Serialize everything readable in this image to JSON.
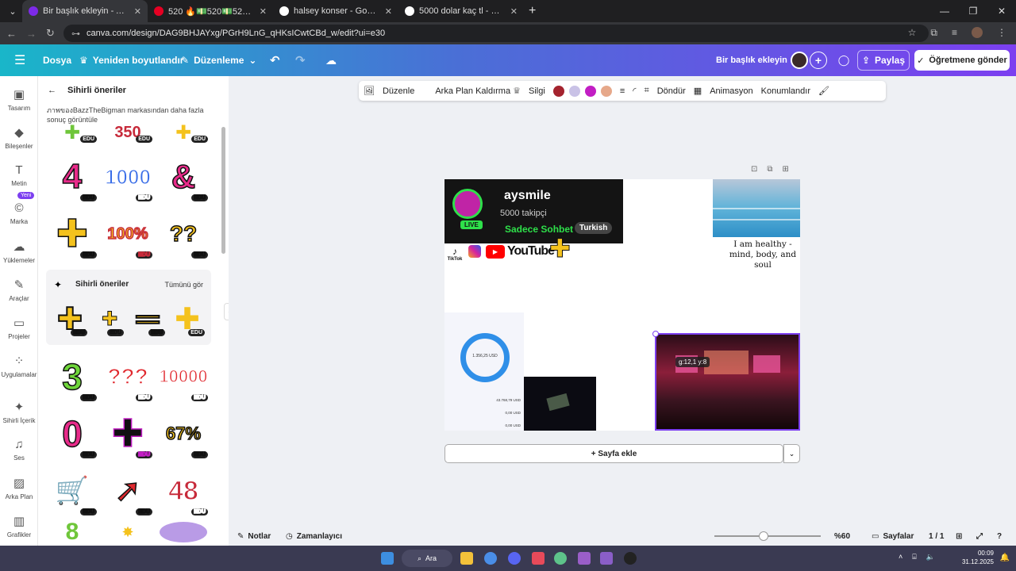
{
  "browser": {
    "tabs": [
      {
        "title": "Bir başlık ekleyin - A4 (Yatay)",
        "active": true,
        "fav_color": "#7d2ae8"
      },
      {
        "title": "520 🔥💵520💵520💵520",
        "active": false,
        "fav_color": "#e60023"
      },
      {
        "title": "halsey konser - Google'da Ara",
        "active": false,
        "fav_color": "#ffffff"
      },
      {
        "title": "5000 dolar kaç tl - Google'da A",
        "active": false,
        "fav_color": "#ffffff"
      }
    ],
    "url": "canva.com/design/DAG9BHJAYxg/PGrH9LnG_qHKsICwtCBd_w/edit?ui=e30"
  },
  "topbar": {
    "file": "Dosya",
    "resize": "Yeniden boyutlandır",
    "edit": "Düzenleme",
    "doc_title": "Bir başlık ekleyin",
    "share": "Paylaş",
    "teacher": "Öğretmene gönder"
  },
  "rail": [
    {
      "label": "Tasarım",
      "icon": "▣"
    },
    {
      "label": "Bileşenler",
      "icon": "◆"
    },
    {
      "label": "Metin",
      "icon": "T"
    },
    {
      "label": "Marka",
      "icon": "©",
      "badge": "Yeni"
    },
    {
      "label": "Yüklemeler",
      "icon": "☁"
    },
    {
      "label": "Araçlar",
      "icon": "✎"
    },
    {
      "label": "Projeler",
      "icon": "▭"
    },
    {
      "label": "Uygulamalar",
      "icon": "⁘"
    },
    {
      "label": "Sihirli İçerik",
      "icon": "✦"
    },
    {
      "label": "Ses",
      "icon": "♫"
    },
    {
      "label": "Arka Plan",
      "icon": "▨"
    },
    {
      "label": "Grafikler",
      "icon": "▥"
    }
  ],
  "panel": {
    "title": "Sihirli öneriler",
    "subtitle": "ภาพของBazzTheBigman markasından daha fazla sonuç görüntüle",
    "magic_title": "Sihirli öneriler",
    "see_all": "Tümünü gör",
    "edu": "EDU",
    "row1": [
      "4",
      "1000",
      "&"
    ],
    "row2": [
      "✚",
      "100%",
      "??"
    ],
    "row3": [
      "3",
      "???",
      "10000"
    ],
    "row4": [
      "0",
      "✚",
      "67%"
    ],
    "row5": [
      "🛒",
      "➚",
      "48"
    ]
  },
  "toolbar": {
    "edit": "Düzenle",
    "bg_remove": "Arka Plan Kaldırma",
    "eraser": "Silgi",
    "rotate": "Döndür",
    "animation": "Animasyon",
    "position": "Konumlandır",
    "swatches": [
      "#a4232e",
      "#c9c2e6",
      "#c21ec4",
      "#e6a88a"
    ]
  },
  "design": {
    "channel": "aysmile",
    "followers": "5000 takipçi",
    "chat": "Sadece Sohbet",
    "lang": "Turkish",
    "live": "LIVE",
    "tiktok": "TikTok",
    "youtube": "YouTube",
    "quote": "I am healthy - mind, body, and soul",
    "coords": "g:12,1 y:8",
    "balance": "1.356,25 USD",
    "rows": [
      "43.768,79 USD",
      "0,00 USD",
      "0,00 USD"
    ]
  },
  "canvas": {
    "add_page": "+ Sayfa ekle"
  },
  "footer": {
    "notes": "Notlar",
    "timer": "Zamanlayıcı",
    "zoom": "%60",
    "pages_label": "Sayfalar",
    "page_count": "1 / 1"
  },
  "taskbar": {
    "search": "Ara",
    "time": "00:09",
    "date": "31.12.2025"
  }
}
